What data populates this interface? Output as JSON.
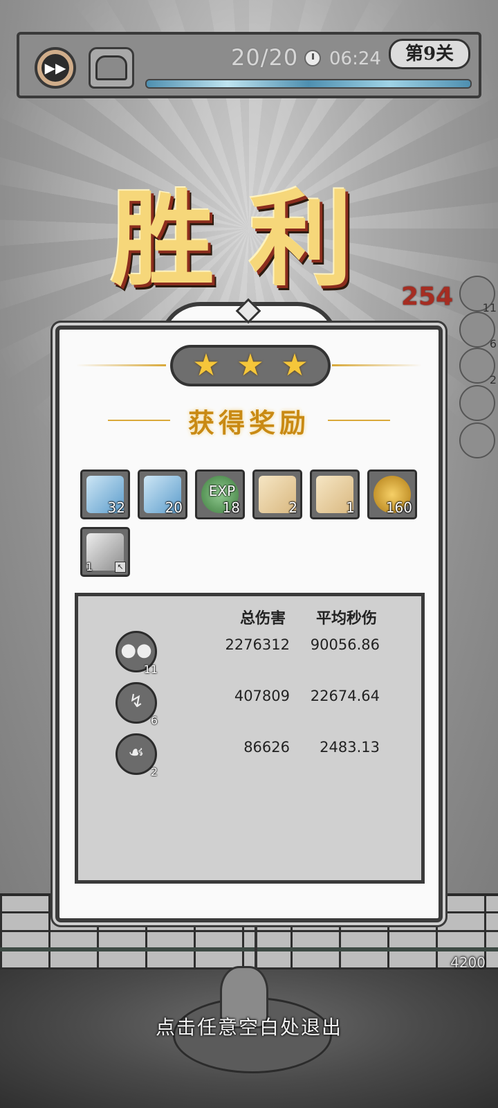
{
  "hud": {
    "wave": "20/20",
    "timer": "06:24",
    "level": "第9关"
  },
  "victory_title": "胜利",
  "floating_damage": "254",
  "side_slots": [
    {
      "icon": "rain-skill-icon",
      "count": "11"
    },
    {
      "icon": "lightning-skill-icon",
      "count": "6"
    },
    {
      "icon": "ghost-skill-icon",
      "count": "2"
    },
    {
      "icon": "empty-slot-icon",
      "count": ""
    },
    {
      "icon": "empty-slot-icon",
      "count": ""
    }
  ],
  "panel": {
    "stars": 3,
    "reward_title": "获得奖励",
    "rewards": [
      {
        "name": "ice-blade-crystal",
        "count": "32",
        "color": "#7fb4dc"
      },
      {
        "name": "ice-ghost-crystal",
        "count": "20",
        "color": "#7fb4dc"
      },
      {
        "name": "exp-orb",
        "label": "EXP",
        "count": "18",
        "color": "#4f8f4f"
      },
      {
        "name": "scroll-necklace",
        "count": "2",
        "color": "#e8cfa0"
      },
      {
        "name": "scroll-helmet",
        "count": "1",
        "color": "#e8cfa0"
      },
      {
        "name": "gold-coin",
        "count": "160",
        "color": "#d8a02a"
      },
      {
        "name": "stone-material",
        "count": "1",
        "color": "#9a9a9a"
      }
    ],
    "stats": {
      "header_total": "总伤害",
      "header_dps": "平均秒伤",
      "rows": [
        {
          "skill": "rain-skill-icon",
          "level": "11",
          "total": "2276312",
          "dps": "90056.86"
        },
        {
          "skill": "lightning-skill-icon",
          "level": "6",
          "total": "407809",
          "dps": "22674.64"
        },
        {
          "skill": "ghost-skill-icon",
          "level": "2",
          "total": "86626",
          "dps": "2483.13"
        }
      ]
    }
  },
  "wall_value": "4200",
  "exit_hint": "点击任意空白处退出"
}
